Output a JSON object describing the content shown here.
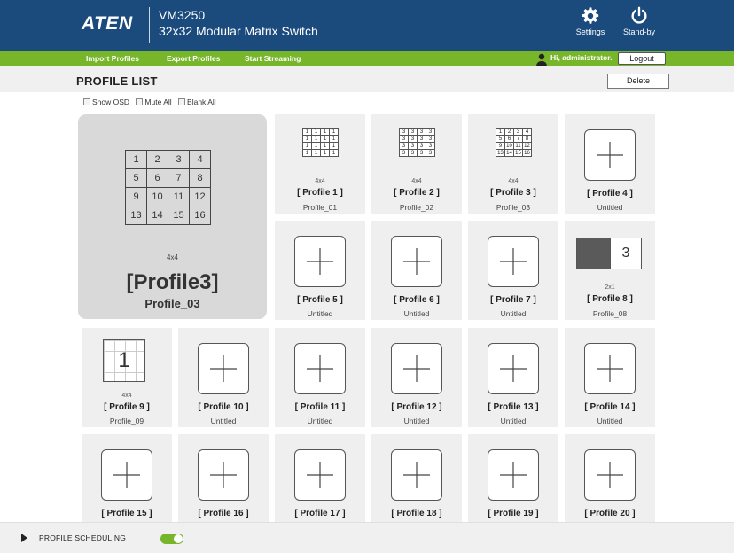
{
  "header": {
    "logo": "ATEN",
    "model": "VM3250",
    "subtitle": "32x32 Modular Matrix Switch",
    "settings_label": "Settings",
    "standby_label": "Stand-by"
  },
  "menu": {
    "items": [
      {
        "label": "Import Profiles"
      },
      {
        "label": "Export Profiles"
      },
      {
        "label": "Start Streaming"
      }
    ],
    "greeting": "Hi, administrator.",
    "logout_label": "Logout"
  },
  "list": {
    "title": "PROFILE LIST",
    "delete_label": "Delete",
    "options": [
      {
        "label": "Show OSD",
        "checked": false
      },
      {
        "label": "Mute All",
        "checked": false
      },
      {
        "label": "Blank All",
        "checked": false
      }
    ]
  },
  "selected": {
    "layout_cells": [
      "1",
      "2",
      "3",
      "4",
      "5",
      "6",
      "7",
      "8",
      "9",
      "10",
      "11",
      "12",
      "13",
      "14",
      "15",
      "16"
    ],
    "dims": "4x4",
    "name": "[Profile3]",
    "title": "Profile_03"
  },
  "profiles": [
    {
      "name": "[ Profile 1 ]",
      "title": "Profile_01",
      "dims": "4x4",
      "layout": "grid",
      "cells": [
        "1",
        "1",
        "1",
        "1",
        "1",
        "1",
        "1",
        "1",
        "1",
        "1",
        "1",
        "1",
        "1",
        "1",
        "1",
        "1"
      ]
    },
    {
      "name": "[ Profile 2 ]",
      "title": "Profile_02",
      "dims": "4x4",
      "layout": "grid",
      "cells": [
        "3",
        "3",
        "3",
        "3",
        "3",
        "3",
        "3",
        "3",
        "3",
        "3",
        "3",
        "3",
        "3",
        "3",
        "3",
        "3"
      ]
    },
    {
      "name": "[ Profile 3 ]",
      "title": "Profile_03",
      "dims": "4x4",
      "layout": "grid",
      "cells": [
        "1",
        "2",
        "3",
        "4",
        "5",
        "6",
        "7",
        "8",
        "9",
        "10",
        "11",
        "12",
        "13",
        "14",
        "15",
        "16"
      ]
    },
    {
      "name": "[ Profile 4 ]",
      "title": "Untitled",
      "dims": "",
      "layout": "empty"
    },
    {
      "name": "[ Profile 5 ]",
      "title": "Untitled",
      "dims": "",
      "layout": "empty"
    },
    {
      "name": "[ Profile 6 ]",
      "title": "Untitled",
      "dims": "",
      "layout": "empty"
    },
    {
      "name": "[ Profile 7 ]",
      "title": "Untitled",
      "dims": "",
      "layout": "empty"
    },
    {
      "name": "[ Profile 8 ]",
      "title": "Profile_08",
      "dims": "2x1",
      "layout": "split",
      "cells": [
        "",
        "3"
      ]
    },
    {
      "name": "[ Profile 9 ]",
      "title": "Profile_09",
      "dims": "4x4",
      "layout": "merged",
      "cells": [
        "1"
      ]
    },
    {
      "name": "[ Profile 10 ]",
      "title": "Untitled",
      "dims": "",
      "layout": "empty"
    },
    {
      "name": "[ Profile 11 ]",
      "title": "Untitled",
      "dims": "",
      "layout": "empty"
    },
    {
      "name": "[ Profile 12 ]",
      "title": "Untitled",
      "dims": "",
      "layout": "empty"
    },
    {
      "name": "[ Profile 13 ]",
      "title": "Untitled",
      "dims": "",
      "layout": "empty"
    },
    {
      "name": "[ Profile 14 ]",
      "title": "Untitled",
      "dims": "",
      "layout": "empty"
    },
    {
      "name": "[ Profile 15 ]",
      "title": "",
      "dims": "",
      "layout": "empty"
    },
    {
      "name": "[ Profile 16 ]",
      "title": "",
      "dims": "",
      "layout": "empty"
    },
    {
      "name": "[ Profile 17 ]",
      "title": "",
      "dims": "",
      "layout": "empty"
    },
    {
      "name": "[ Profile 18 ]",
      "title": "",
      "dims": "",
      "layout": "empty"
    },
    {
      "name": "[ Profile 19 ]",
      "title": "",
      "dims": "",
      "layout": "empty"
    },
    {
      "name": "[ Profile 20 ]",
      "title": "",
      "dims": "",
      "layout": "empty"
    }
  ],
  "footer": {
    "scheduling_label": "PROFILE SCHEDULING",
    "scheduling_enabled": true
  },
  "colors": {
    "header_bg": "#1b4a7d",
    "menu_bg": "#77b52a",
    "card_bg": "#efefef",
    "selected_bg": "#d9d9d9"
  }
}
